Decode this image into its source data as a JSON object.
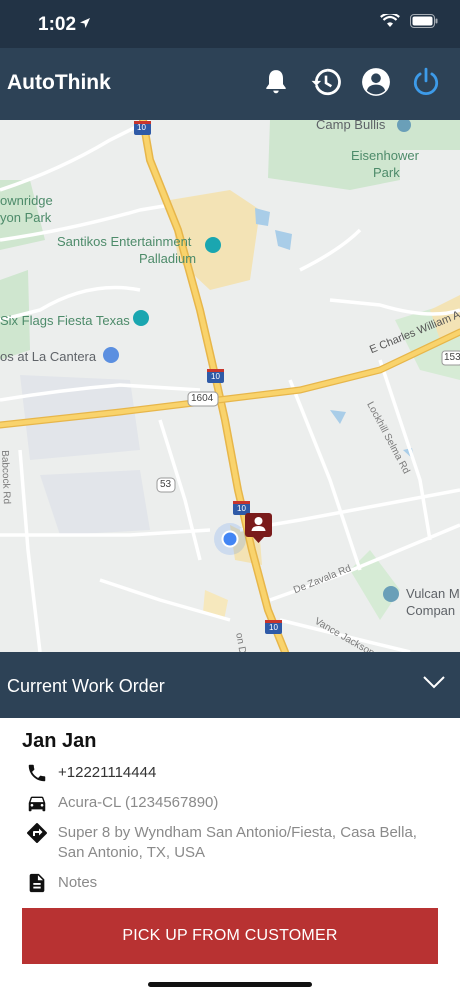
{
  "status": {
    "time": "1:02"
  },
  "app": {
    "title": "AutoThink"
  },
  "map": {
    "places": {
      "camp_bullis": "Camp Bullis",
      "eisenhower": "Eisenhower",
      "eisenhower_park": "Park",
      "ownridge": "ownridge",
      "yon_park": "yon Park",
      "santikos": "Santikos Entertainment",
      "palladium": "Palladium",
      "six_flags": "Six Flags Fiesta Texas",
      "la_cantera": "os at La Cantera",
      "vulcan": "Vulcan M",
      "vulcan2": "Compan"
    },
    "roads": {
      "i10_top": "10",
      "i10_mid": "10",
      "i10_low": "10",
      "i10_bottom": "10",
      "r1604": "1604",
      "r53": "53",
      "r153": "153",
      "charles": "E Charles William A",
      "lockhill": "Lockhill Selma Rd",
      "babcock": "Babcock Rd",
      "dezavala": "De Zavala Rd",
      "vance": "Vance Jackson Rd",
      "vondr": "on Dr"
    }
  },
  "work_order": {
    "header": "Current Work Order",
    "customer_name": "Jan Jan",
    "phone": "+12221114444",
    "vehicle": "Acura-CL (1234567890)",
    "address": "Super 8 by Wyndham San Antonio/Fiesta,  Casa Bella,  San Antonio,  TX,  USA",
    "notes": "Notes",
    "action": "PICK UP FROM CUSTOMER"
  },
  "colors": {
    "header": "#2d4256",
    "status": "#223345",
    "action": "#b83232",
    "power": "#3d9be9"
  }
}
